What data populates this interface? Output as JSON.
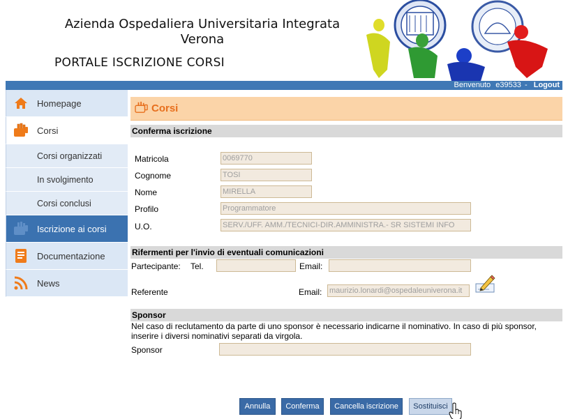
{
  "header": {
    "org_line1": "Azienda Ospedaliera Universitaria Integrata",
    "org_line2": "Verona",
    "portal_title": "PORTALE ISCRIZIONE CORSI"
  },
  "topbar": {
    "welcome": "Benvenuto",
    "user": "e39533",
    "separator": "-",
    "logout": "Logout"
  },
  "sidebar": {
    "items": [
      {
        "label": "Homepage",
        "icon": "home-icon"
      },
      {
        "label": "Corsi",
        "icon": "courses-icon"
      },
      {
        "label": "Corsi organizzati"
      },
      {
        "label": "In svolgimento"
      },
      {
        "label": "Corsi conclusi"
      },
      {
        "label": "Iscrizione ai corsi",
        "icon": "enroll-icon"
      },
      {
        "label": "Documentazione",
        "icon": "document-icon"
      },
      {
        "label": "News",
        "icon": "rss-icon"
      }
    ]
  },
  "page": {
    "title": "Corsi",
    "confirm_section": "Conferma iscrizione",
    "fields": {
      "matricola": {
        "label": "Matricola",
        "value": "0069770"
      },
      "cognome": {
        "label": "Cognome",
        "value": "TOSI"
      },
      "nome": {
        "label": "Nome",
        "value": "MIRELLA"
      },
      "profilo": {
        "label": "Profilo",
        "value": "Programmatore"
      },
      "uo": {
        "label": "U.O.",
        "value": "SERV./UFF. AMM./TECNICI-DIR.AMMINISTRA.- SR SISTEMI INFO"
      }
    },
    "refs_section": "Rifermenti per l'invio di eventuali comunicazioni",
    "partecipante": {
      "label": "Partecipante:",
      "tel_label": "Tel.",
      "tel_value": "",
      "email_label": "Email:",
      "email_value": ""
    },
    "referente": {
      "label": "Referente",
      "email_label": "Email:",
      "email_value": "maurizio.lonardi@ospedaleuniverona.it"
    },
    "sponsor_section": "Sponsor",
    "sponsor_note": "Nel caso di reclutamento da parte di uno sponsor è necessario indicarne il nominativo. In caso di più sponsor, inserire i diversi nominativi separati da virgola.",
    "sponsor_label": "Sponsor",
    "sponsor_value": ""
  },
  "buttons": {
    "annulla": "Annulla",
    "conferma": "Conferma",
    "cancella": "Cancella iscrizione",
    "sostituisci": "Sostituisci"
  },
  "colors": {
    "accent_blue": "#3f78b5",
    "title_orange": "#e76f1d",
    "title_bg": "#fbd4a8"
  }
}
